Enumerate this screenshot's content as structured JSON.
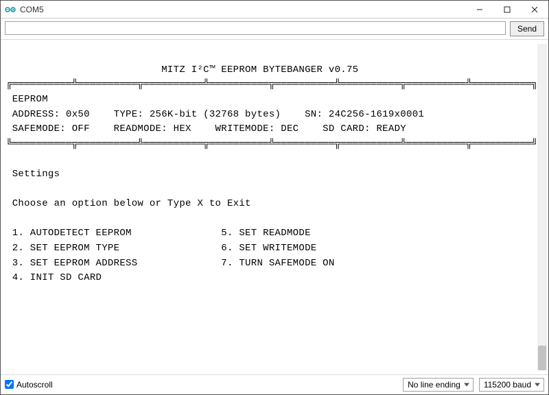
{
  "window": {
    "title": "COM5",
    "icon_name": "arduino-icon"
  },
  "send": {
    "input_value": "",
    "input_placeholder": "",
    "button_label": "Send"
  },
  "terminal": {
    "header_title": "MITZ I²C™ EEPROM BYTEBANGER v0.75",
    "border_top": "╔══════════╩══════════╦══════════╩══════════╦══════════╩══════════╦══════════╩══════════╗",
    "info_line1_label": " EEPROM",
    "address_label": " ADDRESS:",
    "address_value": "0x50",
    "type_label": "TYPE:",
    "type_value": "256K-bit (32768 bytes)",
    "sn_label": "SN:",
    "sn_value": "24C256-1619x0001",
    "safemode_label": " SAFEMODE:",
    "safemode_value": "OFF",
    "readmode_label": "READMODE:",
    "readmode_value": "HEX",
    "writemode_label": "WRITEMODE:",
    "writemode_value": "DEC",
    "sdcard_label": "SD CARD:",
    "sdcard_value": "READY",
    "border_bot": "╚══════════╦══════════╩══════════╦══════════╩══════════╦══════════╩══════════╦══════════╝",
    "section_title": " Settings",
    "prompt": " Choose an option below or Type X to Exit",
    "options_left": [
      " 1. AUTODETECT EEPROM",
      " 2. SET EEPROM TYPE",
      " 3. SET EEPROM ADDRESS",
      " 4. INIT SD CARD"
    ],
    "options_right": [
      "5. SET READMODE",
      "6. SET WRITEMODE",
      "7. TURN SAFEMODE ON",
      ""
    ]
  },
  "bottombar": {
    "autoscroll_label": "Autoscroll",
    "autoscroll_checked": true,
    "line_ending_selected": "No line ending",
    "baud_selected": "115200 baud"
  },
  "colors": {
    "arduino_teal": "#00979D"
  }
}
